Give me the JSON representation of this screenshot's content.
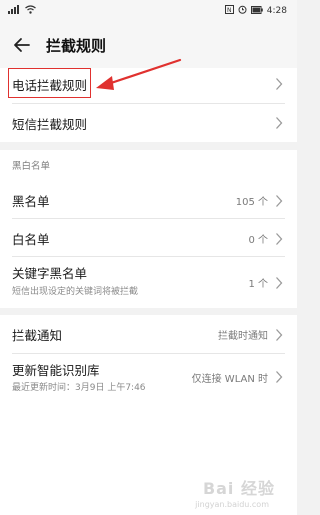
{
  "status_bar": {
    "signal_text": "4G",
    "time": "4:28"
  },
  "app_bar": {
    "title": "拦截规则"
  },
  "rules": [
    {
      "label": "电话拦截规则"
    },
    {
      "label": "短信拦截规则"
    }
  ],
  "blacklist_section": {
    "header": "黑白名单",
    "items": [
      {
        "label": "黑名单",
        "value": "105 个"
      },
      {
        "label": "白名单",
        "value": "0 个"
      },
      {
        "label": "关键字黑名单",
        "subtitle": "短信出现设定的关键词将被拦截",
        "value": "1 个"
      }
    ]
  },
  "other_section": {
    "items": [
      {
        "label": "拦截通知",
        "value": "拦截时通知"
      },
      {
        "label": "更新智能识别库",
        "subtitle": "最近更新时间：3月9日 上午7:46",
        "value": "仅连接 WLAN 时"
      }
    ]
  },
  "watermark": {
    "text": "Bai 经验",
    "sub": "jingyan.baidu.com"
  },
  "colors": {
    "annotation": "#e0312f",
    "background": "#f2f2f2"
  }
}
